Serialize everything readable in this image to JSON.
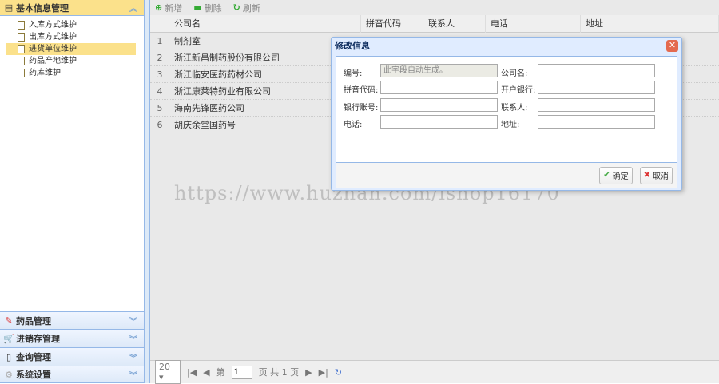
{
  "sidebar": {
    "top_header": "基本信息管理",
    "items": [
      "入库方式维护",
      "出库方式维护",
      "进货单位维护",
      "药品产地维护",
      "药库维护"
    ],
    "sections": [
      "药品管理",
      "进销存管理",
      "查询管理",
      "系统设置"
    ]
  },
  "toolbar": {
    "add": "新增",
    "delete": "删除",
    "refresh": "刷新"
  },
  "grid": {
    "columns": [
      "公司名",
      "拼音代码",
      "联系人",
      "电话",
      "地址"
    ],
    "rows": [
      {
        "n": "1",
        "name": "制剂室"
      },
      {
        "n": "2",
        "name": "浙江新昌制药股份有限公司"
      },
      {
        "n": "3",
        "name": "浙江临安医药药材公司"
      },
      {
        "n": "4",
        "name": "浙江康莱特药业有限公司"
      },
      {
        "n": "5",
        "name": "海南先锋医药公司"
      },
      {
        "n": "6",
        "name": "胡庆余堂国药号"
      }
    ]
  },
  "pager": {
    "page_size": "20",
    "page_prefix": "第",
    "page": "1",
    "page_suffix": "页 共 1 页"
  },
  "dialog": {
    "title": "修改信息",
    "labels": {
      "id": "编号:",
      "company": "公司名:",
      "pinyin": "拼音代码:",
      "bank": "开户银行:",
      "account": "银行账号:",
      "contact": "联系人:",
      "phone": "电话:",
      "address": "地址:"
    },
    "id_value": "此字段自动生成。",
    "ok": "确定",
    "cancel": "取消"
  },
  "watermark": "https://www.huzhan.com/ishop16170"
}
